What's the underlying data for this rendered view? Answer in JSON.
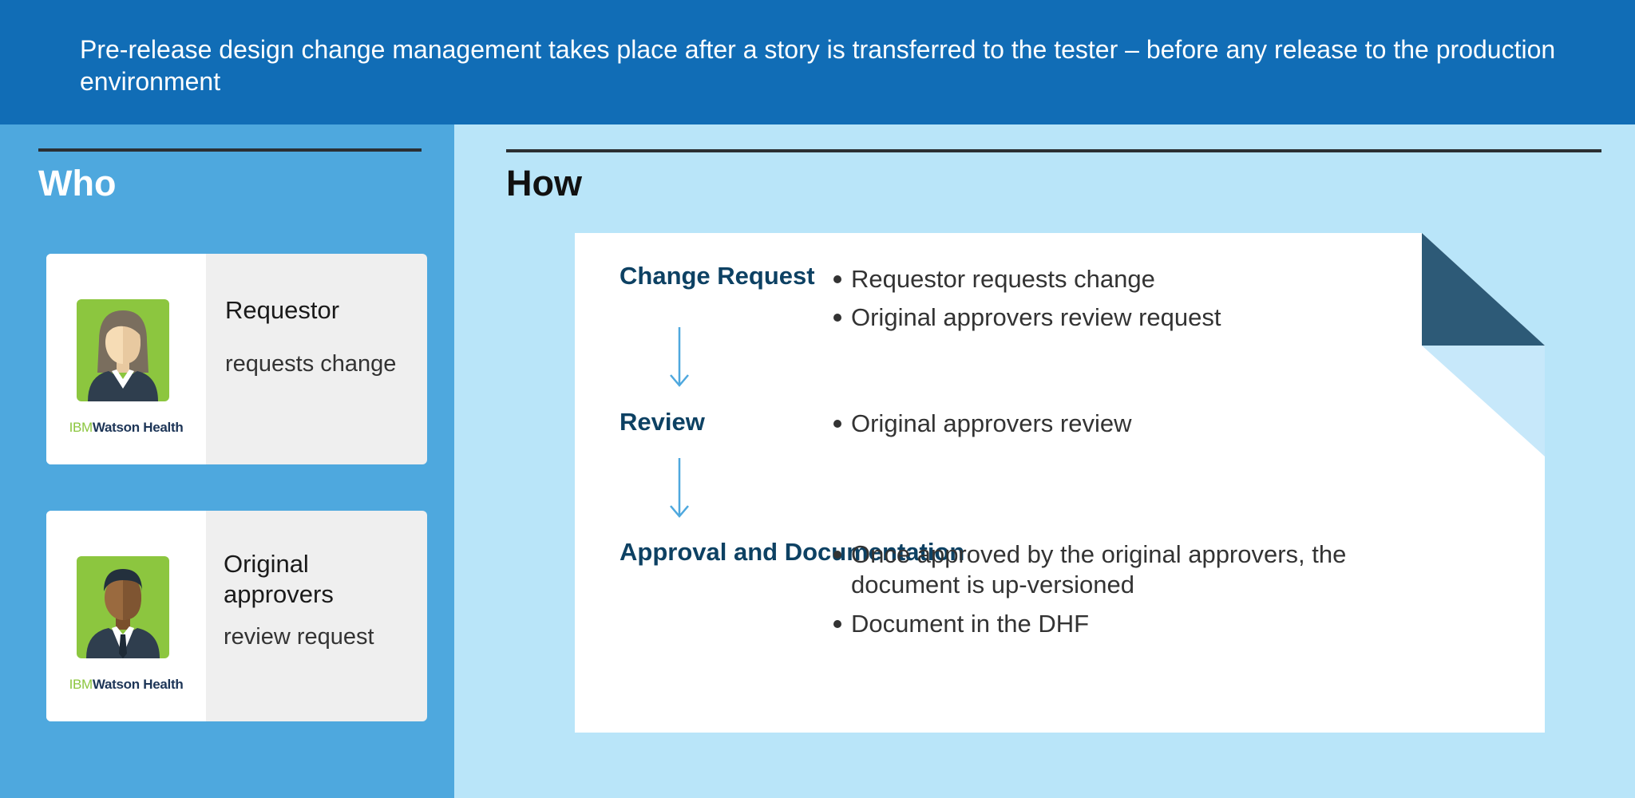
{
  "banner": {
    "text": "Pre-release design change management takes place after a story is transferred to the tester – before any release to the production environment"
  },
  "who": {
    "title": "Who",
    "cards": [
      {
        "role": "Requestor",
        "action": "requests change",
        "brand_ibm": "IBM",
        "brand_name": "Watson Health",
        "icon": "female-user-icon"
      },
      {
        "role": "Original approvers",
        "action": "review request",
        "brand_ibm": "IBM",
        "brand_name": "Watson Health",
        "icon": "male-user-icon"
      }
    ]
  },
  "how": {
    "title": "How",
    "steps": [
      {
        "title": "Change Request",
        "bullets": [
          "Requestor requests change",
          "Original approvers review request"
        ]
      },
      {
        "title": "Review",
        "bullets": [
          "Original approvers review"
        ]
      },
      {
        "title": "Approval and Documentation",
        "bullets": [
          "Once approved by the original approvers, the document is up-versioned",
          "Document in the DHF"
        ]
      }
    ]
  },
  "colors": {
    "banner": "#116db6",
    "who_panel": "#4ea8de",
    "how_panel": "#b9e5f9",
    "step_title": "#0d4163",
    "arrow": "#4ea8de",
    "avatar_bg": "#8cc63f",
    "doc_fold": "#2d5a77"
  }
}
